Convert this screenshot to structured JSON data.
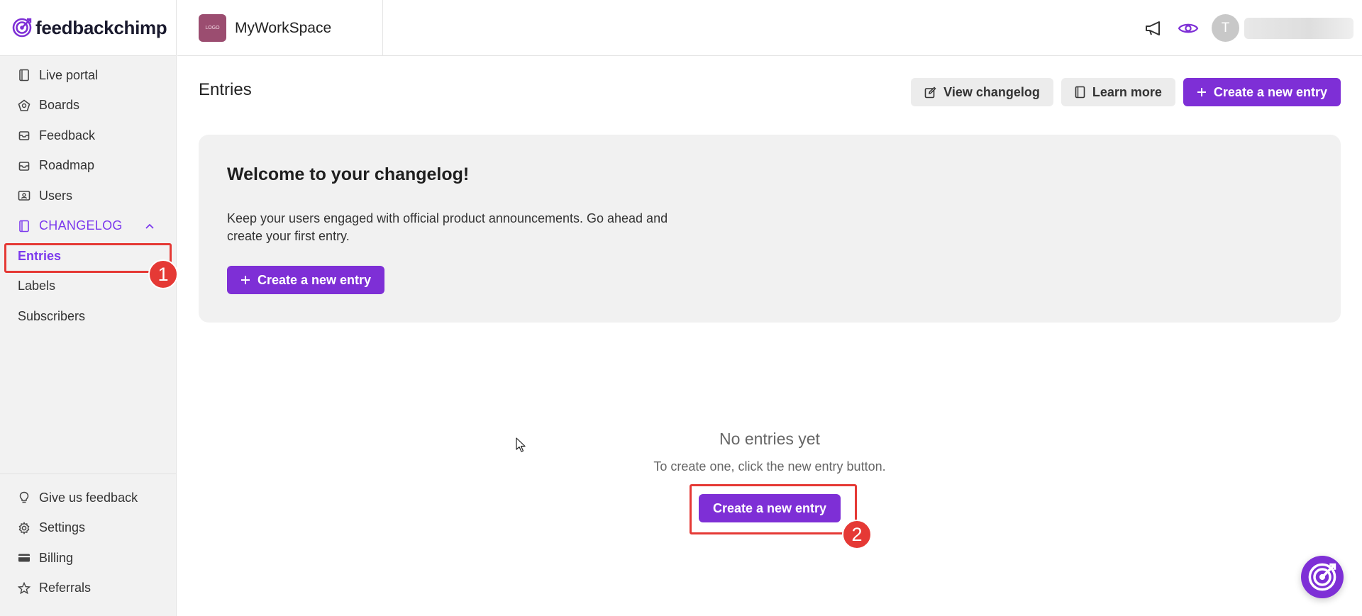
{
  "app": {
    "name": "feedbackchimp"
  },
  "sidebar": {
    "items": [
      {
        "label": "Live portal",
        "icon": "portal-icon"
      },
      {
        "label": "Boards",
        "icon": "boards-icon"
      },
      {
        "label": "Feedback",
        "icon": "inbox-icon"
      },
      {
        "label": "Roadmap",
        "icon": "inbox-icon"
      },
      {
        "label": "Users",
        "icon": "users-icon"
      }
    ],
    "changelog": {
      "label": "CHANGELOG",
      "icon": "book-icon",
      "expanded": true,
      "subitems": [
        {
          "label": "Entries",
          "active": true
        },
        {
          "label": "Labels",
          "active": false
        },
        {
          "label": "Subscribers",
          "active": false
        }
      ]
    },
    "bottom": [
      {
        "label": "Give us feedback",
        "icon": "lightbulb-icon"
      },
      {
        "label": "Settings",
        "icon": "gear-icon"
      },
      {
        "label": "Billing",
        "icon": "card-icon"
      },
      {
        "label": "Referrals",
        "icon": "star-icon"
      }
    ]
  },
  "topbar": {
    "workspace_logo_text": "LOGO",
    "workspace_name": "MyWorkSpace",
    "avatar_initial": "T"
  },
  "main": {
    "title": "Entries",
    "actions": {
      "view_changelog": "View changelog",
      "learn_more": "Learn more",
      "create_entry": "Create a new entry"
    },
    "welcome": {
      "title": "Welcome to your changelog!",
      "text": "Keep your users engaged with official product announcements. Go ahead and create your first entry.",
      "button": "Create a new entry"
    },
    "empty_state": {
      "title": "No entries yet",
      "subtitle": "To create one, click the new entry button.",
      "button": "Create a new entry"
    }
  },
  "annotations": {
    "badge_1": "1",
    "badge_2": "2"
  },
  "colors": {
    "accent": "#7e2fd6",
    "highlight": "#e53935",
    "sidebar_bg": "#f2f2f2"
  }
}
